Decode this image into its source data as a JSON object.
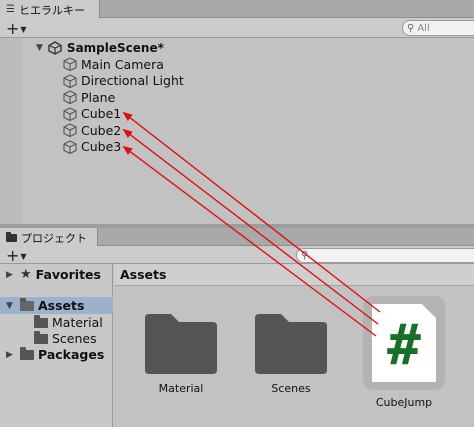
{
  "hierarchy": {
    "tab_label": "ヒエラルキー",
    "search_placeholder": "All",
    "scene_name": "SampleScene*",
    "objects": [
      "Main Camera",
      "Directional Light",
      "Plane",
      "Cube1",
      "Cube2",
      "Cube3"
    ]
  },
  "project": {
    "tab_label": "プロジェクト",
    "sidebar": {
      "favorites": "Favorites",
      "assets": "Assets",
      "material": "Material",
      "scenes": "Scenes",
      "packages": "Packages"
    },
    "breadcrumb": "Assets",
    "assets": [
      {
        "label": "Material",
        "kind": "folder"
      },
      {
        "label": "Scenes",
        "kind": "folder"
      },
      {
        "label": "CubeJump",
        "kind": "script",
        "glyph": "#"
      }
    ]
  },
  "colors": {
    "arrow": "#e01010",
    "script_glyph": "#1a6f2a",
    "selection": "#9cb1cd"
  },
  "icons": {
    "add": "plus-icon",
    "search": "search-icon",
    "gameobject": "cube-icon",
    "scene": "unity-scene-icon",
    "favorites": "star-icon",
    "folder": "folder-icon"
  }
}
